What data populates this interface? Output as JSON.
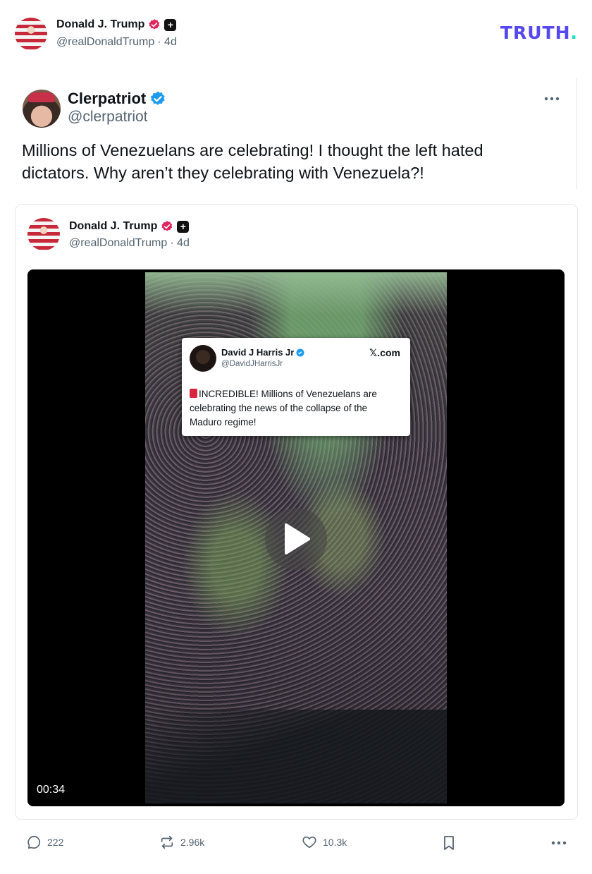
{
  "header": {
    "author_name": "Donald J. Trump",
    "author_handle": "@realDonaldTrump",
    "time_ago": "· 4d",
    "logo_text": "TRUTH",
    "logo_dot": ".",
    "colors": {
      "logo": "#5448ee",
      "logo_dot": "#17e0c4",
      "verified_red": "#e0245e"
    }
  },
  "repost": {
    "author_name": "Clerpatriot",
    "author_handle": "@clerpatriot",
    "more_icon": "more-dots-icon",
    "text": "Millions of Venezuelans are celebrating! I thought the left hated dictators. Why aren’t they celebrating with Venezuela?!",
    "colors": {
      "verified_blue": "#1d9bf0"
    }
  },
  "quoted": {
    "author_name": "Donald J. Trump",
    "author_handle": "@realDonaldTrump",
    "time_ago": "· 4d",
    "video": {
      "duration": "00:34",
      "play_icon": "play-icon",
      "embedded_post": {
        "name": "David J Harris Jr",
        "handle": "@DavidJHarrisJr",
        "source": "𝕏.com",
        "text": "INCREDIBLE! Millions of Venezuelans are celebrating the news of the collapse of the Maduro regime!"
      }
    }
  },
  "actions": {
    "replies": "222",
    "reposts": "2.96k",
    "likes": "10.3k",
    "icons": [
      "reply-icon",
      "repost-icon",
      "heart-icon",
      "bookmark-icon",
      "more-dots-icon"
    ]
  }
}
